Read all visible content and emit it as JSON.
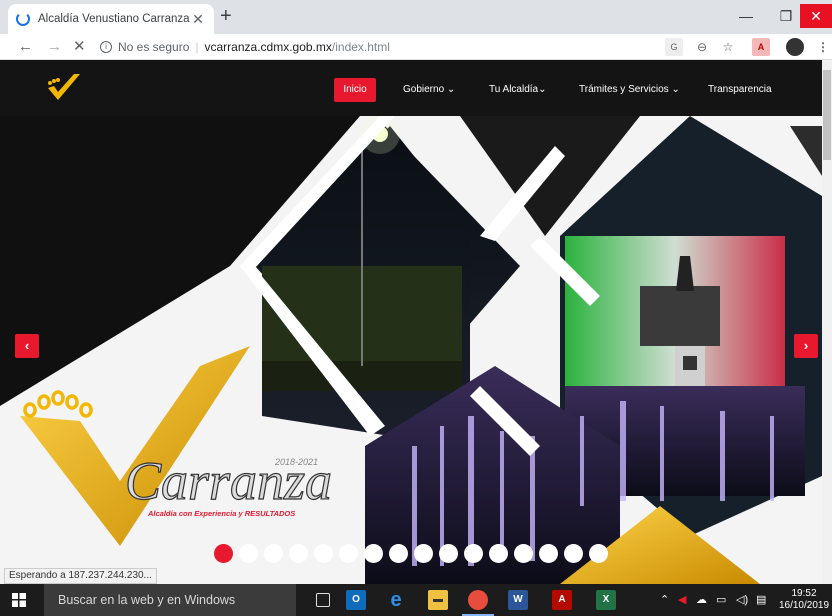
{
  "browser": {
    "tab_title": "Alcaldía Venustiano Carranza",
    "security_label": "No es seguro",
    "url_host": "vcarranza.cdmx.gob.mx",
    "url_path": "/index.html",
    "status_text": "Esperando a 187.237.244.230..."
  },
  "site": {
    "nav": {
      "inicio": "Inicio",
      "gobierno": "Gobierno",
      "tu_alcaldia": "Tu Alcaldía",
      "tramites": "Trámites y Servicios",
      "transparencia": "Transparencia"
    },
    "hero": {
      "brand": "Carranza",
      "period": "2018-2021",
      "tagline": "Alcaldía con Experiencia y RESULTADOS"
    },
    "slides": {
      "count": 16,
      "active_index": 0
    },
    "colors": {
      "accent": "#e8192f",
      "gold": "#f2b705",
      "dark": "#141414"
    }
  },
  "taskbar": {
    "search_placeholder": "Buscar en la web y en Windows",
    "time": "19:52",
    "date": "16/10/2019"
  }
}
